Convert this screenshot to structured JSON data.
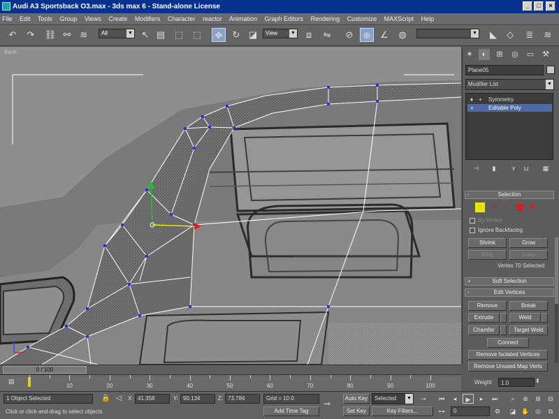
{
  "window": {
    "title": "Audi A3 Sportsback O3.max - 3ds max 6 - Stand-alone License"
  },
  "menu": [
    "File",
    "Edit",
    "Tools",
    "Group",
    "Views",
    "Create",
    "Modifiers",
    "Character",
    "reactor",
    "Animation",
    "Graph Editors",
    "Rendering",
    "Customize",
    "MAXScript",
    "Help"
  ],
  "toolbar": {
    "selection_filter": "All",
    "ref_coord": "View",
    "named_selection": ""
  },
  "viewport": {
    "label": "Back"
  },
  "command_panel": {
    "object_name": "Plane05",
    "modifier_list": "Modifier List",
    "stack": [
      {
        "label": "Symmetry"
      },
      {
        "label": "Editable Poly"
      }
    ],
    "selection": {
      "title": "Selection",
      "by_vertex": "By Vertex",
      "ignore_backfacing": "Ignore Backfacing",
      "shrink": "Shrink",
      "grow": "Grow",
      "ring": "Ring",
      "loop": "Loop",
      "status": "Vertex 70 Selected"
    },
    "soft_selection": {
      "title": "Soft Selection"
    },
    "edit_vertices": {
      "title": "Edit Vertices",
      "remove": "Remove",
      "break": "Break",
      "extrude": "Extrude",
      "weld": "Weld",
      "chamfer": "Chamfer",
      "target_weld": "Target Weld",
      "connect": "Connect",
      "remove_isolated": "Remove Isolated Vertices",
      "remove_unused": "Remove Unused Map Verts",
      "weight_label": "Weight",
      "weight_value": "1.0"
    }
  },
  "timeline": {
    "frame": "0 / 100",
    "ticks": [
      "10",
      "20",
      "30",
      "40",
      "50",
      "60",
      "70",
      "80",
      "90",
      "100"
    ],
    "key_frame_fraction": 0.0
  },
  "status": {
    "objects_selected": "1 Object Selected",
    "prompt": "Click or click-and-drag to select objects",
    "x_label": "X:",
    "x": "41.358",
    "y_label": "Y:",
    "y": "90.134",
    "z_label": "Z:",
    "z": "73.784",
    "grid": "Grid = 10.0",
    "add_time_tag": "Add Time Tag",
    "auto_key": "Auto Key",
    "selected": "Selected",
    "set_key": "Set Key",
    "key_filters": "Key Filters...",
    "current_frame": "0"
  },
  "colors": {
    "titlebar": "#06318e",
    "selection_accent": "#e8e800",
    "vertex_marker": "#3030e0",
    "gizmo_x": "#e02020",
    "gizmo_y": "#20c020"
  }
}
